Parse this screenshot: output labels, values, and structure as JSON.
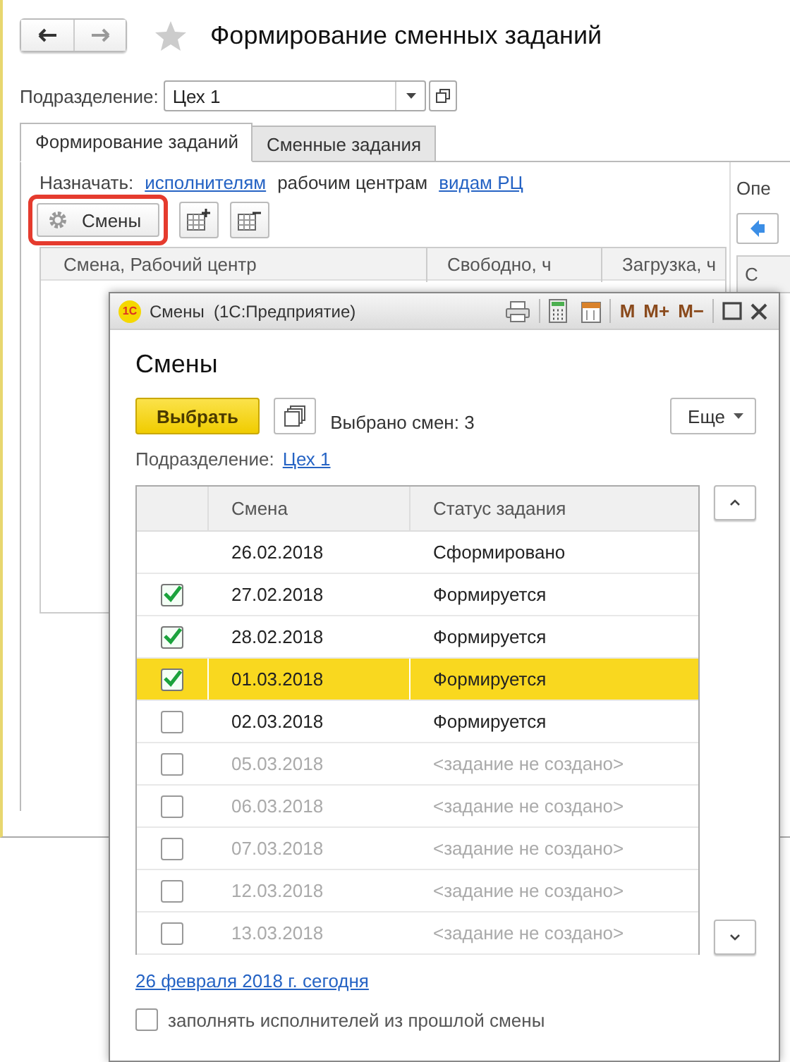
{
  "main_window": {
    "title": "Формирование сменных заданий",
    "department": {
      "label": "Подразделение:",
      "value": "Цех 1"
    },
    "tabs": [
      {
        "label": "Формирование заданий",
        "selected": true
      },
      {
        "label": "Сменные задания",
        "selected": false
      }
    ],
    "assign": {
      "label": "Назначать:",
      "options": [
        {
          "label": "исполнителям",
          "selected": false
        },
        {
          "label": "рабочим центрам",
          "selected": true
        },
        {
          "label": "видам РЦ",
          "selected": false
        }
      ]
    },
    "shifts_button": {
      "label": "Смены",
      "highlighted": true
    },
    "table": {
      "columns": [
        "Смена, Рабочий центр",
        "Свободно, ч",
        "Загрузка, ч"
      ]
    },
    "right_panel": {
      "label": "Опе",
      "column_1": "С"
    }
  },
  "dialog": {
    "logo": "1С",
    "window_title": "Смены  (1С:Предприятие)",
    "toolbar": [
      "M",
      "M+",
      "M−"
    ],
    "heading": "Смены",
    "select_button": "Выбрать",
    "selected_count": "Выбрано смен: 3",
    "more_button": "Еще",
    "department": {
      "label": "Подразделение:",
      "value": "Цех 1"
    },
    "columns": [
      "Смена",
      "Статус задания"
    ],
    "rows": [
      {
        "kind": "plain",
        "date": "26.02.2018",
        "status": "Сформировано",
        "selected": false,
        "created": true
      },
      {
        "kind": "checkbox",
        "date": "27.02.2018",
        "status": "Формируется",
        "checked": true,
        "selected": false,
        "created": true
      },
      {
        "kind": "checkbox",
        "date": "28.02.2018",
        "status": "Формируется",
        "checked": true,
        "selected": false,
        "created": true
      },
      {
        "kind": "checkbox",
        "date": "01.03.2018",
        "status": "Формируется",
        "checked": true,
        "selected": true,
        "created": true
      },
      {
        "kind": "checkbox",
        "date": "02.03.2018",
        "status": "Формируется",
        "checked": false,
        "selected": false,
        "created": true
      },
      {
        "kind": "checkbox",
        "date": "05.03.2018",
        "status": "<задание не создано>",
        "checked": false,
        "selected": false,
        "created": false
      },
      {
        "kind": "checkbox",
        "date": "06.03.2018",
        "status": "<задание не создано>",
        "checked": false,
        "selected": false,
        "created": false
      },
      {
        "kind": "checkbox",
        "date": "07.03.2018",
        "status": "<задание не создано>",
        "checked": false,
        "selected": false,
        "created": false
      },
      {
        "kind": "checkbox",
        "date": "12.03.2018",
        "status": "<задание не создано>",
        "checked": false,
        "selected": false,
        "created": false
      },
      {
        "kind": "checkbox",
        "date": "13.03.2018",
        "status": "<задание не создано>",
        "checked": false,
        "selected": false,
        "created": false
      }
    ],
    "today_link": "26 февраля 2018 г. сегодня",
    "fill_option": {
      "label": "заполнять исполнителей из прошлой смены",
      "checked": false
    }
  }
}
